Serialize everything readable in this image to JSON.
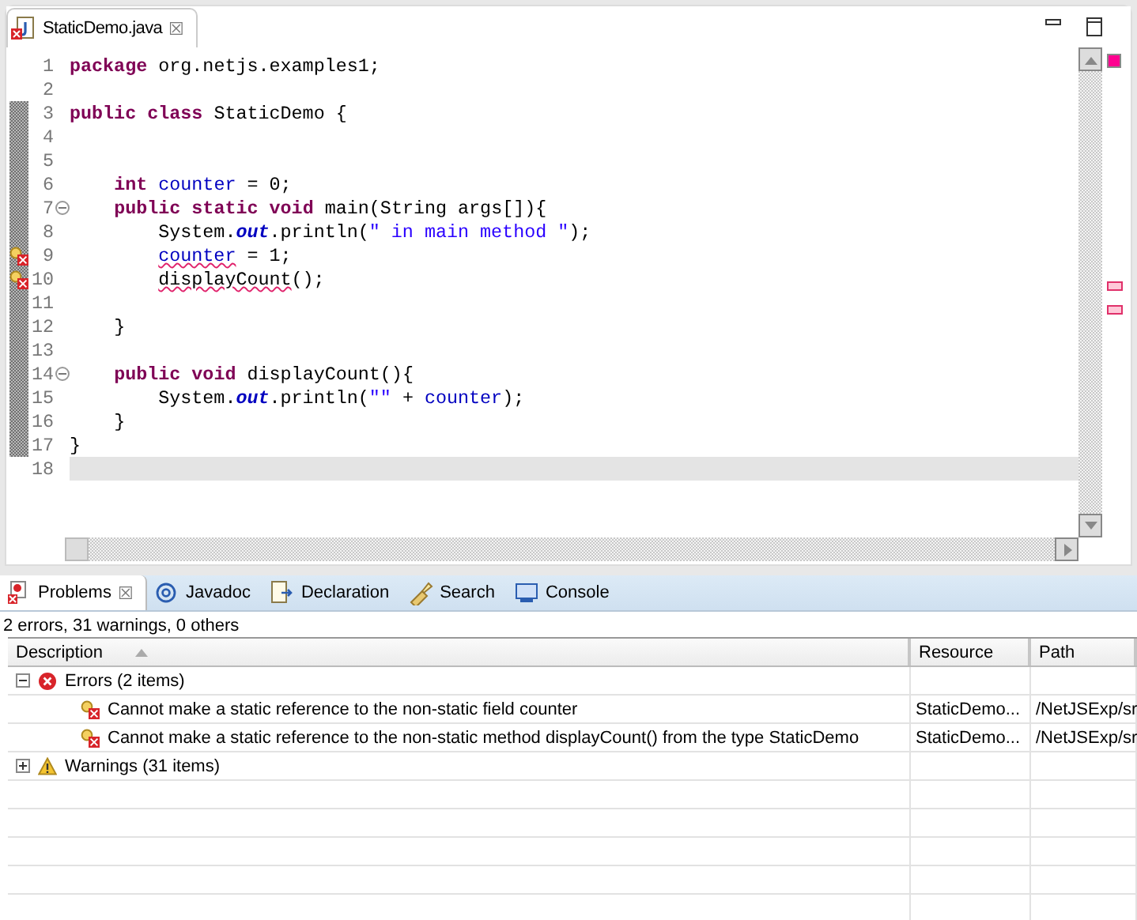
{
  "editor": {
    "tab": {
      "title": "StaticDemo.java",
      "close": "☒",
      "selected": true
    },
    "lines": [
      {
        "number": "1",
        "fold": false,
        "error": false,
        "current": false,
        "tokens": [
          {
            "text": "package",
            "kind": "keyword"
          },
          {
            "text": " org.netjs.examples1;",
            "kind": "plain"
          }
        ]
      },
      {
        "number": "2",
        "fold": false,
        "error": false,
        "current": false
      },
      {
        "number": "3",
        "fold": false,
        "error": false,
        "current": false,
        "tokens": [
          {
            "text": "public",
            "kind": "keyword"
          },
          {
            "text": " class",
            "kind": "keyword"
          },
          {
            "text": " StaticDemo {",
            "kind": "plain"
          }
        ]
      },
      {
        "number": "4",
        "fold": false,
        "error": false,
        "current": false
      },
      {
        "number": "5",
        "fold": false,
        "error": false,
        "current": false
      },
      {
        "number": "6",
        "fold": false,
        "error": false,
        "current": false,
        "tokens": [
          {
            "text": "    int",
            "kind": "keyword"
          },
          {
            "text": " counter",
            "kind": "field"
          },
          {
            "text": " = 0;",
            "kind": "plain"
          }
        ]
      },
      {
        "number": "7",
        "fold": true,
        "error": false,
        "current": false,
        "tokens": [
          {
            "text": "    public",
            "kind": "keyword"
          },
          {
            "text": " static",
            "kind": "keyword"
          },
          {
            "text": " void",
            "kind": "keyword"
          },
          {
            "text": " main(String args[]){",
            "kind": "plain"
          }
        ]
      },
      {
        "number": "8",
        "fold": false,
        "error": false,
        "current": false,
        "tokens": [
          {
            "text": "        System.",
            "kind": "plain"
          },
          {
            "text": "out",
            "kind": "static"
          },
          {
            "text": ".println(",
            "kind": "plain"
          },
          {
            "text": "\" in main method \"",
            "kind": "string"
          },
          {
            "text": ");",
            "kind": "plain"
          }
        ]
      },
      {
        "number": "9",
        "fold": false,
        "error": true,
        "current": false,
        "tokens": [
          {
            "text": "        counter",
            "kind": "field-error"
          },
          {
            "text": " = 1;",
            "kind": "plain"
          }
        ]
      },
      {
        "number": "10",
        "fold": false,
        "error": true,
        "current": false,
        "tokens": [
          {
            "text": "        displayCount",
            "kind": "plain-error"
          },
          {
            "text": "();",
            "kind": "plain"
          }
        ]
      },
      {
        "number": "11",
        "fold": false,
        "error": false,
        "current": false
      },
      {
        "number": "12",
        "fold": false,
        "error": false,
        "current": false,
        "tokens": [
          {
            "text": "    }",
            "kind": "plain"
          }
        ]
      },
      {
        "number": "13",
        "fold": false,
        "error": false,
        "current": false
      },
      {
        "number": "14",
        "fold": true,
        "error": false,
        "current": false,
        "tokens": [
          {
            "text": "    public",
            "kind": "keyword"
          },
          {
            "text": " void",
            "kind": "keyword"
          },
          {
            "text": " displayCount(){",
            "kind": "plain"
          }
        ]
      },
      {
        "number": "15",
        "fold": false,
        "error": false,
        "current": false,
        "tokens": [
          {
            "text": "        System.",
            "kind": "plain"
          },
          {
            "text": "out",
            "kind": "static"
          },
          {
            "text": ".println(",
            "kind": "plain"
          },
          {
            "text": "\"\"",
            "kind": "string"
          },
          {
            "text": " + ",
            "kind": "plain"
          },
          {
            "text": "counter",
            "kind": "field"
          },
          {
            "text": ");",
            "kind": "plain"
          }
        ]
      },
      {
        "number": "16",
        "fold": false,
        "error": false,
        "current": false,
        "tokens": [
          {
            "text": "    }",
            "kind": "plain"
          }
        ]
      },
      {
        "number": "17",
        "fold": false,
        "error": false,
        "current": false,
        "tokens": [
          {
            "text": "}",
            "kind": "plain"
          }
        ]
      },
      {
        "number": "18",
        "fold": false,
        "error": false,
        "current": true
      }
    ]
  },
  "panel": {
    "tabs": [
      {
        "label": "Problems",
        "close": "☒",
        "kind": "problems",
        "selected": true
      },
      {
        "label": "Javadoc",
        "kind": "javadoc",
        "selected": false
      },
      {
        "label": "Declaration",
        "kind": "declaration",
        "selected": false
      },
      {
        "label": "Search",
        "kind": "search",
        "selected": false
      },
      {
        "label": "Console",
        "kind": "console",
        "selected": false
      }
    ],
    "summary": "2 errors, 31 warnings, 0 others",
    "columns": [
      "Description",
      "Resource",
      "Path"
    ],
    "groups": [
      {
        "label": "Errors (2 items)",
        "kind": "error",
        "expanded": true,
        "children": [
          {
            "description": "Cannot make a static reference to the non-static field counter",
            "resource": "StaticDemo...",
            "path": "/NetJSExp/sr"
          },
          {
            "description": "Cannot make a static reference to the non-static method displayCount() from the type StaticDemo",
            "resource": "StaticDemo...",
            "path": "/NetJSExp/sr"
          }
        ]
      },
      {
        "label": "Warnings (31 items)",
        "kind": "warning",
        "expanded": false
      }
    ]
  }
}
